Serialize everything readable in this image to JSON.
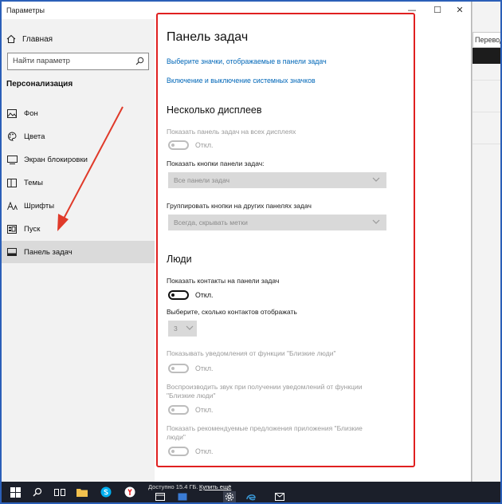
{
  "window": {
    "title": "Параметры",
    "controls": {
      "minimize": "—",
      "maximize": "☐",
      "close": "✕"
    }
  },
  "background_app": {
    "tab_label": "Переводч"
  },
  "sidebar": {
    "home_label": "Главная",
    "search_placeholder": "Найти параметр",
    "section_title": "Персонализация",
    "items": [
      {
        "label": "Фон",
        "icon": "picture-icon"
      },
      {
        "label": "Цвета",
        "icon": "palette-icon"
      },
      {
        "label": "Экран блокировки",
        "icon": "lock-screen-icon"
      },
      {
        "label": "Темы",
        "icon": "themes-icon"
      },
      {
        "label": "Шрифты",
        "icon": "fonts-icon"
      },
      {
        "label": "Пуск",
        "icon": "start-icon"
      },
      {
        "label": "Панель задач",
        "icon": "taskbar-icon",
        "active": true
      }
    ]
  },
  "main": {
    "title": "Панель задач",
    "links": [
      "Выберите значки, отображаемые в панели задач",
      "Включение и выключение системных значков"
    ],
    "multi_display": {
      "heading": "Несколько дисплеев",
      "show_on_all_label": "Показать панель задач на всех дисплеях",
      "show_on_all_state": "Откл.",
      "show_buttons_label": "Показать кнопки панели задач:",
      "show_buttons_value": "Все панели задач",
      "group_buttons_label": "Группировать кнопки на других панелях задач",
      "group_buttons_value": "Всегда, скрывать метки"
    },
    "people": {
      "heading": "Люди",
      "show_contacts_label": "Показать контакты на панели задач",
      "show_contacts_state": "Откл.",
      "contacts_count_label": "Выберите, сколько контактов отображать",
      "contacts_count_value": "3",
      "notifications_label": "Показывать уведомления от функции \"Близкие люди\"",
      "notifications_state": "Откл.",
      "sound_label": "Воспроизводить звук при получении уведомлений от функции \"Близкие люди\"",
      "sound_state": "Откл.",
      "suggestions_label": "Показать рекомендуемые предложения приложения \"Близкие люди\"",
      "suggestions_state": "Откл."
    }
  },
  "taskbar": {
    "status_text": "Доступно 15.4 ГБ.",
    "status_link": "Купить ещё",
    "icons": [
      "windows-start-icon",
      "search-icon",
      "task-view-icon",
      "file-explorer-icon",
      "skype-icon",
      "yandex-icon",
      "calendar-icon",
      "app-icon",
      "settings-icon"
    ]
  },
  "colors": {
    "accent_link": "#0067b8",
    "highlight_box": "#e02020",
    "annotation_arrow": "#e03a2a",
    "taskbar": "#1b1f2a"
  }
}
